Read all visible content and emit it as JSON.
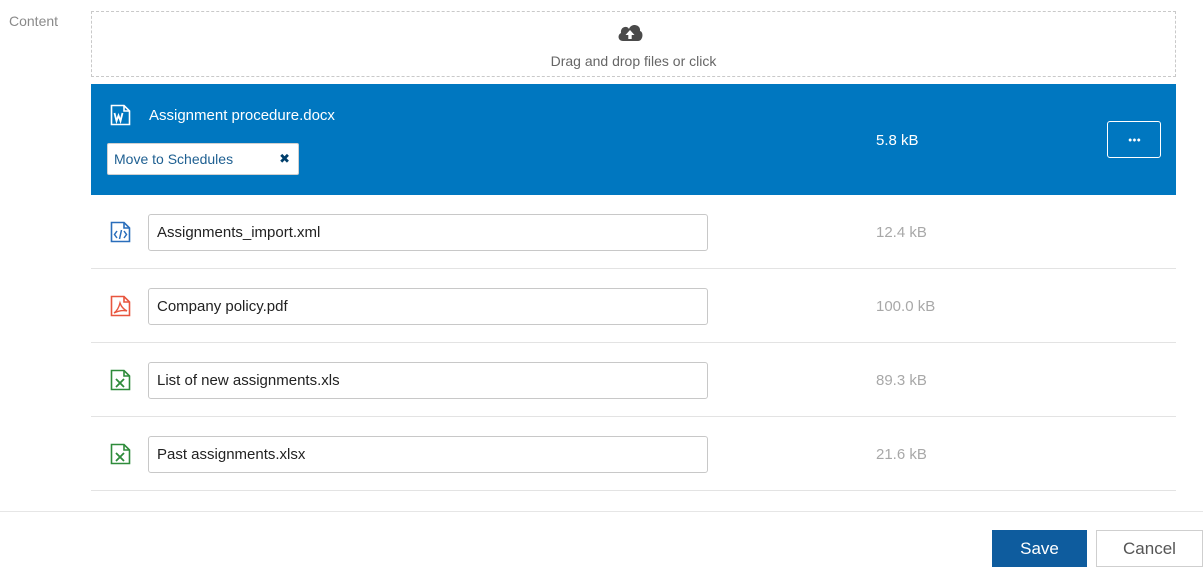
{
  "field": {
    "label": "Content"
  },
  "dropzone": {
    "text": "Drag and drop files or click",
    "icon": "cloud-upload-icon"
  },
  "selected_file": {
    "name": "Assignment procedure.docx",
    "size": "5.8 kB",
    "icon": "word-file-icon",
    "tag": {
      "label": "Move to Schedules",
      "remove_icon": "close-icon"
    },
    "more_icon": "ellipsis-icon",
    "highlight_color": "#0077c0"
  },
  "files": [
    {
      "name": "Assignments_import.xml",
      "size": "12.4 kB",
      "icon": "xml-file-icon"
    },
    {
      "name": "Company policy.pdf",
      "size": "100.0 kB",
      "icon": "pdf-file-icon"
    },
    {
      "name": "List of new assignments.xls",
      "size": "89.3 kB",
      "icon": "excel-file-icon"
    },
    {
      "name": "Past assignments.xlsx",
      "size": "21.6 kB",
      "icon": "excel-file-icon"
    }
  ],
  "footer": {
    "save_label": "Save",
    "cancel_label": "Cancel",
    "save_color": "#0e5c9e"
  }
}
